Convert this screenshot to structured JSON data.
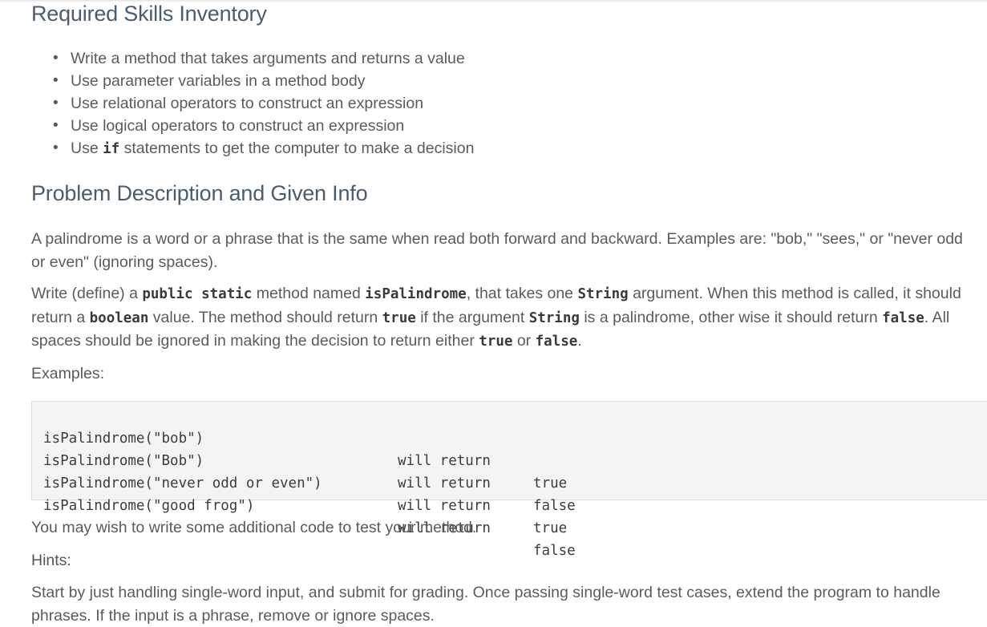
{
  "skills": {
    "title": "Required Skills Inventory",
    "items": [
      {
        "pre": "Write a method that takes arguments and returns a value",
        "code": "",
        "post": ""
      },
      {
        "pre": "Use parameter variables in a method body",
        "code": "",
        "post": ""
      },
      {
        "pre": "Use relational operators to construct an expression",
        "code": "",
        "post": ""
      },
      {
        "pre": "Use logical operators to construct an expression",
        "code": "",
        "post": ""
      },
      {
        "pre": "Use ",
        "code": "if",
        "post": " statements to get the computer to make a decision"
      }
    ]
  },
  "problem": {
    "title": "Problem Description and Given Info",
    "p1": "A palindrome is a word or a phrase that is the same when read both forward and backward. Examples are: \"bob,\" \"sees,\" or \"never odd or even\" (ignoring spaces).",
    "p2": {
      "t1": "Write (define) a ",
      "c1": "public static",
      "t2": " method named ",
      "c2": "isPalindrome",
      "t3": ", that takes one ",
      "c3": "String",
      "t4": " argument. When this method is called, it should return a ",
      "c4": "boolean",
      "t5": " value. The method should return ",
      "c5": "true",
      "t6": " if the argument ",
      "c6": "String",
      "t7": " is a palindrome, other wise it should return ",
      "c7": "false",
      "t8": ". All spaces should be ignored in making the decision to return either ",
      "c8": "true",
      "t9": " or ",
      "c9": "false",
      "t10": "."
    },
    "examples_label": "Examples:",
    "examples": [
      {
        "call": "isPalindrome(\"bob\")",
        "will": "will return",
        "result": "true"
      },
      {
        "call": "isPalindrome(\"Bob\")",
        "will": "will return",
        "result": "false"
      },
      {
        "call": "isPalindrome(\"never odd or even\")",
        "will": "will return",
        "result": "true"
      },
      {
        "call": "isPalindrome(\"good frog\")",
        "will": "will return",
        "result": "false"
      }
    ],
    "test_note": "You may wish to write some additional code to test your method.",
    "hints_label": "Hints:",
    "hint_text": "Start by just handling single-word input, and submit for grading. Once passing single-word test cases, extend the program to handle phrases. If the input is a phrase, remove or ignore spaces."
  }
}
